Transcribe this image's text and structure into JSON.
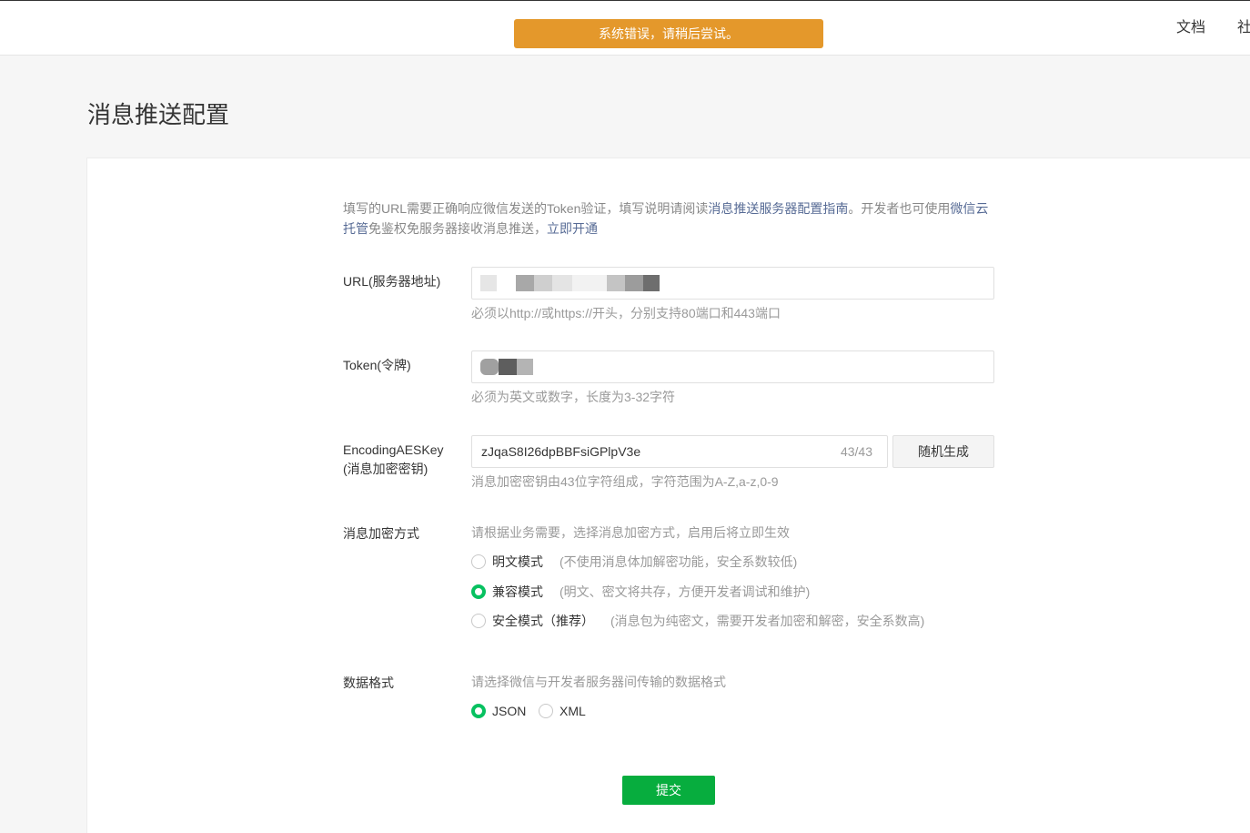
{
  "toast": {
    "text": "系统错误，请稍后尝试。"
  },
  "nav": {
    "docs": "文档",
    "community": "社"
  },
  "page": {
    "title": "消息推送配置"
  },
  "intro": {
    "part1": "填写的URL需要正确响应微信发送的Token验证，填写说明请阅读",
    "link_guide": "消息推送服务器配置指南",
    "part2": "。开发者也可使用",
    "link_cloud": "微信云托管",
    "part3": "免鉴权免服务器接收消息推送，",
    "link_open": "立即开通"
  },
  "url_field": {
    "label": "URL(服务器地址)",
    "tip": "必须以http://或https://开头，分别支持80端口和443端口"
  },
  "token_field": {
    "label": "Token(令牌)",
    "tip": "必须为英文或数字，长度为3-32字符"
  },
  "aes_field": {
    "label_line1": "EncodingAESKey",
    "label_line2": "(消息加密密钥)",
    "value": "zJqaS8I26dpBBFsiGPlpV3e",
    "count": "43/43",
    "generate_label": "随机生成",
    "tip": "消息加密密钥由43位字符组成，字符范围为A-Z,a-z,0-9"
  },
  "encryption": {
    "label": "消息加密方式",
    "hint": "请根据业务需要，选择消息加密方式，启用后将立即生效",
    "options": [
      {
        "label": "明文模式",
        "desc": "(不使用消息体加解密功能，安全系数较低)",
        "checked": false
      },
      {
        "label": "兼容模式",
        "desc": "(明文、密文将共存，方便开发者调试和维护)",
        "checked": true
      },
      {
        "label": "安全模式（推荐）",
        "desc": "(消息包为纯密文，需要开发者加密和解密，安全系数高)",
        "checked": false
      }
    ]
  },
  "data_format": {
    "label": "数据格式",
    "hint": "请选择微信与开发者服务器间传输的数据格式",
    "options": [
      {
        "label": "JSON",
        "checked": true
      },
      {
        "label": "XML",
        "checked": false
      }
    ]
  },
  "submit_label": "提交",
  "colors": {
    "toast_bg": "#e4982b",
    "accent_green": "#07c160",
    "submit_green": "#07ad3e",
    "link_blue": "#576b95"
  }
}
